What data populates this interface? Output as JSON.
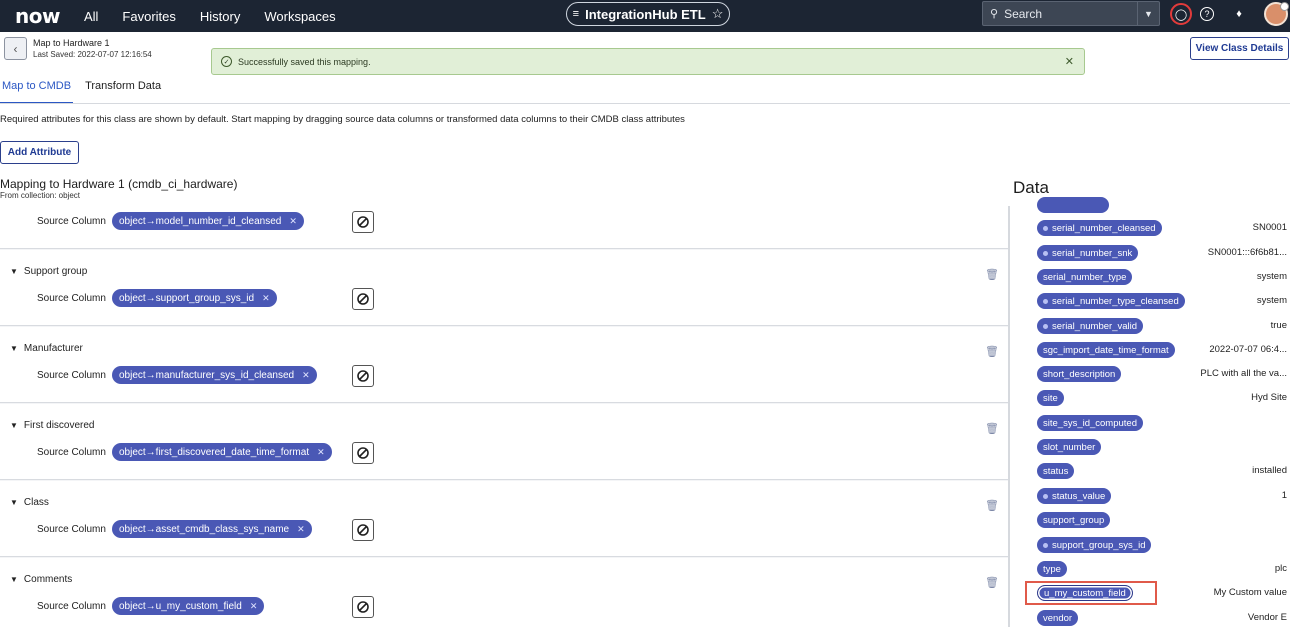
{
  "topnav": {
    "logo": "now",
    "links": [
      "All",
      "Favorites",
      "History",
      "Workspaces"
    ],
    "app_title": "IntegrationHub ETL",
    "search_placeholder": "Search"
  },
  "header": {
    "record_title": "Map to Hardware 1",
    "last_saved": "Last Saved: 2022-07-07 12:16:54",
    "toast": "Successfully saved this mapping.",
    "view_class_details": "View Class Details"
  },
  "tabs": [
    "Map to CMDB",
    "Transform Data"
  ],
  "hint": "Required attributes for this class are shown by default. Start mapping by dragging source data columns or transformed data columns to their CMDB class attributes",
  "add_attribute": "Add Attribute",
  "mapping": {
    "title": "Mapping to Hardware 1 (cmdb_ci_hardware)",
    "subtitle": "From collection: object",
    "source_label": "Source Column",
    "first_row_chip": "object→model_number_id_cleansed",
    "rows": [
      {
        "label": "Support group",
        "chip": "object→support_group_sys_id"
      },
      {
        "label": "Manufacturer",
        "chip": "object→manufacturer_sys_id_cleansed"
      },
      {
        "label": "First discovered",
        "chip": "object→first_discovered_date_time_format"
      },
      {
        "label": "Class",
        "chip": "object→asset_cmdb_class_sys_name"
      },
      {
        "label": "Comments",
        "chip": "object→u_my_custom_field"
      }
    ]
  },
  "data_panel": {
    "title": "Data",
    "items": [
      {
        "name": "serial_number_cleansed",
        "value": "SN0001",
        "dot": true
      },
      {
        "name": "serial_number_snk",
        "value": "SN0001:::6f6b81...",
        "dot": true
      },
      {
        "name": "serial_number_type",
        "value": "system",
        "dot": false
      },
      {
        "name": "serial_number_type_cleansed",
        "value": "system",
        "dot": true
      },
      {
        "name": "serial_number_valid",
        "value": "true",
        "dot": true
      },
      {
        "name": "sgc_import_date_time_format",
        "value": "2022-07-07 06:4...",
        "dot": false
      },
      {
        "name": "short_description",
        "value": "PLC with all the va...",
        "dot": false
      },
      {
        "name": "site",
        "value": "Hyd Site",
        "dot": false
      },
      {
        "name": "site_sys_id_computed",
        "value": "",
        "dot": false
      },
      {
        "name": "slot_number",
        "value": "",
        "dot": false
      },
      {
        "name": "status",
        "value": "installed",
        "dot": false
      },
      {
        "name": "status_value",
        "value": "1",
        "dot": true
      },
      {
        "name": "support_group",
        "value": "",
        "dot": false
      },
      {
        "name": "support_group_sys_id",
        "value": "",
        "dot": true
      },
      {
        "name": "type",
        "value": "plc",
        "dot": false
      },
      {
        "name": "u_my_custom_field",
        "value": "My Custom value",
        "dot": false
      },
      {
        "name": "vendor",
        "value": "Vendor E",
        "dot": false
      }
    ]
  }
}
